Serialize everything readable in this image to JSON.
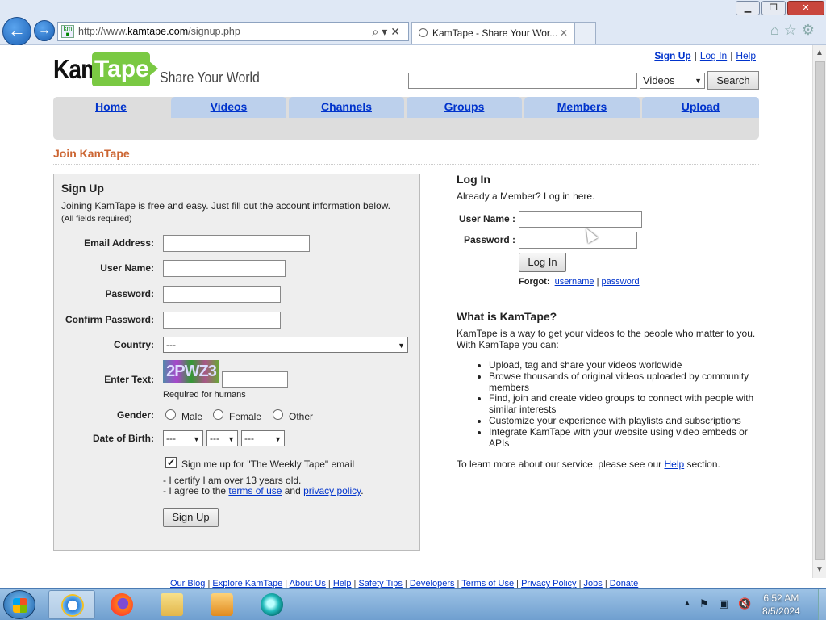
{
  "browser": {
    "url_prefix": "http://www.",
    "url_domain": "kamtape.com",
    "url_path": "/signup.php",
    "tab_title": "KamTape - Share Your Wor...",
    "tab_close": "✕",
    "win_min": "▁",
    "win_restore": "❐",
    "win_close": "✕"
  },
  "header": {
    "logo_kam": "Kam",
    "logo_tape": "Tape",
    "slogan": "Share Your World",
    "links": [
      "Sign Up",
      "Log In",
      "Help"
    ],
    "search_select": "Videos",
    "search_button": "Search"
  },
  "nav": {
    "tabs": [
      "Home",
      "Videos",
      "Channels",
      "Groups",
      "Members",
      "Upload"
    ]
  },
  "page_title": "Join KamTape",
  "signup": {
    "heading": "Sign Up",
    "intro": "Joining KamTape is free and easy. Just fill out the account information below.",
    "required_note": "(All fields required)",
    "labels": {
      "email": "Email Address:",
      "username": "User Name:",
      "password": "Password:",
      "confirm": "Confirm Password:",
      "country": "Country:",
      "captcha": "Enter Text:",
      "gender": "Gender:",
      "dob": "Date of Birth:"
    },
    "country_value": "---",
    "captcha_text": "2PWZ3",
    "captcha_note": "Required for humans",
    "genders": [
      "Male",
      "Female",
      "Other"
    ],
    "dob_values": [
      "---",
      "---",
      "---"
    ],
    "newsletter_checked": "✔",
    "newsletter_label": "Sign me up for \"The Weekly Tape\" email",
    "certify": "- I certify I am over 13 years old.",
    "agree_prefix": "- I agree to the ",
    "terms_link": "terms of use",
    "agree_and": " and ",
    "privacy_link": "privacy policy",
    "agree_suffix": ".",
    "button": "Sign Up"
  },
  "login": {
    "heading": "Log In",
    "subtitle": "Already a Member? Log in here.",
    "username_label": "User Name :",
    "password_label": "Password :",
    "button": "Log In",
    "forgot_label": "Forgot:",
    "forgot_username": "username",
    "forgot_sep": " | ",
    "forgot_password": "password"
  },
  "about": {
    "heading": "What is KamTape?",
    "intro": "KamTape is a way to get your videos to the people who matter to you. With KamTape you can:",
    "bullets": [
      "Upload, tag and share your videos worldwide",
      "Browse thousands of original videos uploaded by community members",
      "Find, join and create video groups to connect with people with similar interests",
      "Customize your experience with playlists and subscriptions",
      "Integrate KamTape with your website using video embeds or APIs"
    ],
    "outro_prefix": "To learn more about our service, please see our ",
    "outro_link": "Help",
    "outro_suffix": " section."
  },
  "footer": {
    "links": [
      "Our Blog",
      "Explore KamTape",
      "About Us",
      "Help",
      "Safety Tips",
      "Developers",
      "Terms of Use",
      "Privacy Policy",
      "Jobs",
      "Donate"
    ]
  },
  "taskbar": {
    "time": "6:52 AM",
    "date": "8/5/2024"
  },
  "colors": {
    "accent_orange": "#cc6633",
    "logo_green": "#7ac943",
    "nav_tab": "#bcd0ec",
    "link": "#0033cc"
  }
}
